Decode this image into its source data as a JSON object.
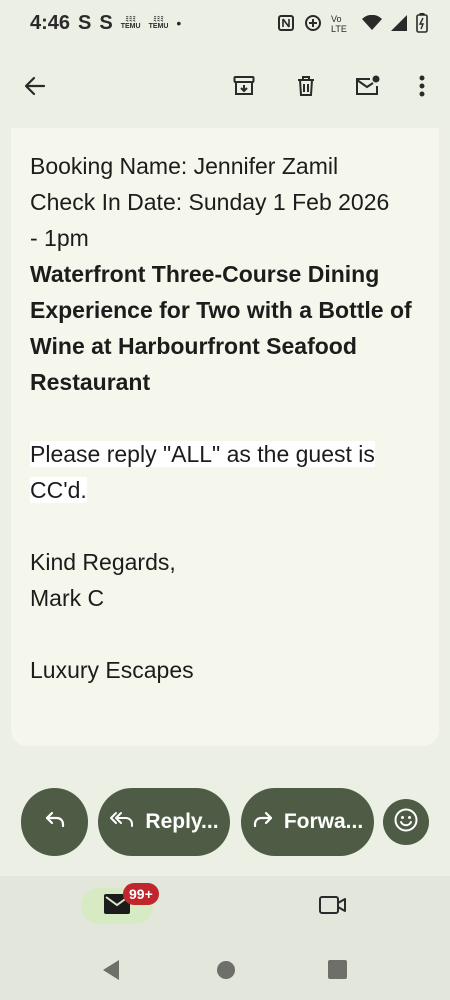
{
  "status_bar": {
    "time": "4:46",
    "s1": "S",
    "s2": "S",
    "temu1_top": "ﾐﾐﾐ",
    "temu1_bottom": "TEMU",
    "temu2_bottom": "TEMU",
    "dot": "•",
    "icons": [
      "nfc-icon",
      "data-saver-icon",
      "volte-icon",
      "wifi-icon",
      "signal-icon",
      "battery-icon"
    ]
  },
  "app_bar": {
    "icons": [
      "back-arrow-icon",
      "archive-icon",
      "delete-icon",
      "mark-unread-icon",
      "more-vert-icon"
    ]
  },
  "email": {
    "booking_name": "Booking Name: Jennifer Zamil",
    "check_in_line1": "Check In Date: Sunday 1 Feb 2026",
    "check_in_line2": "- 1pm",
    "experience_title": "Waterfront Three-Course Dining Experience for Two with a Bottle of Wine at Harbourfront Seafood Restaurant",
    "reply_line1": "Please reply \"ALL\" as the guest is",
    "reply_line2": "CC'd.",
    "regards": "Kind Regards,",
    "sender": "Mark C",
    "company": "Luxury Escapes"
  },
  "actions": {
    "reply_all_label": "Reply...",
    "forward_label": "Forwa..."
  },
  "bottom_nav": {
    "mail_badge": "99+"
  },
  "colors": {
    "background": "#ecefe4",
    "card": "#f5f7ec",
    "action_pill": "#4e5c45",
    "mail_pill": "#d6ebc4",
    "badge": "#c0262d"
  }
}
